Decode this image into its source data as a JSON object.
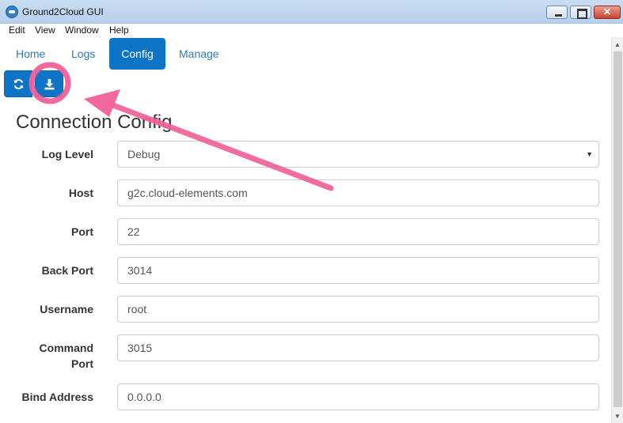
{
  "window": {
    "title": "Ground2Cloud GUI"
  },
  "menubar": {
    "items": [
      "Edit",
      "View",
      "Window",
      "Help"
    ]
  },
  "nav": {
    "tabs": [
      {
        "label": "Home",
        "active": false
      },
      {
        "label": "Logs",
        "active": false
      },
      {
        "label": "Config",
        "active": true
      },
      {
        "label": "Manage",
        "active": false
      }
    ]
  },
  "toolbar": {
    "refresh_icon": "refresh-icon",
    "download_icon": "download-icon"
  },
  "page": {
    "heading": "Connection Config"
  },
  "form": {
    "fields": [
      {
        "label": "Log Level",
        "value": "Debug",
        "type": "select"
      },
      {
        "label": "Host",
        "value": "g2c.cloud-elements.com"
      },
      {
        "label": "Port",
        "value": "22"
      },
      {
        "label": "Back Port",
        "value": "3014"
      },
      {
        "label": "Username",
        "value": "root"
      },
      {
        "label": "Command Port",
        "label_line1": "Command",
        "label_line2": "Port",
        "value": "3015"
      },
      {
        "label": "Bind Address",
        "value": "0.0.0.0"
      }
    ]
  },
  "colors": {
    "accent": "#0d74c6",
    "link": "#2a7bc0",
    "annotation": "#f0609a"
  }
}
